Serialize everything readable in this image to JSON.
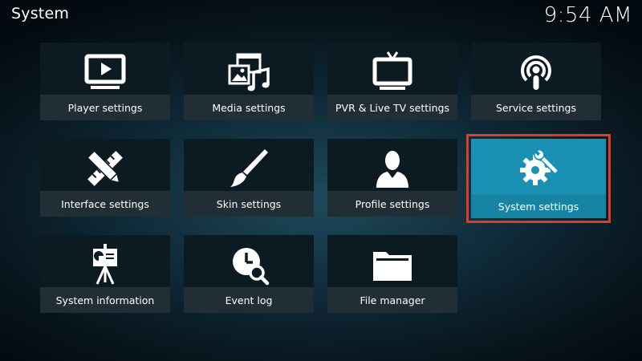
{
  "header": {
    "title": "System",
    "clock": "9:54 AM"
  },
  "colors": {
    "tile_background": "#0c1a22",
    "focused_tile": "#1a90b4",
    "focus_outline": "#e23a24",
    "text": "#ffffff"
  },
  "tiles": [
    {
      "label": "Player settings",
      "icon": "tv-play-icon"
    },
    {
      "label": "Media settings",
      "icon": "media-icon"
    },
    {
      "label": "PVR & Live TV settings",
      "icon": "live-tv-icon"
    },
    {
      "label": "Service settings",
      "icon": "podcast-icon"
    },
    {
      "label": "Interface settings",
      "icon": "pencil-ruler-icon"
    },
    {
      "label": "Skin settings",
      "icon": "paintbrush-icon"
    },
    {
      "label": "Profile settings",
      "icon": "user-icon"
    },
    {
      "label": "System settings",
      "icon": "gear-wrench-icon",
      "focused": true
    },
    {
      "label": "System information",
      "icon": "presentation-icon"
    },
    {
      "label": "Event log",
      "icon": "clock-search-icon"
    },
    {
      "label": "File manager",
      "icon": "folder-icon"
    }
  ]
}
